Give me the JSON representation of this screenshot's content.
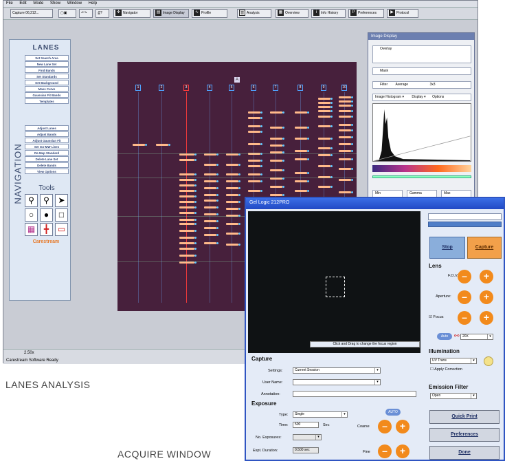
{
  "main": {
    "menu": [
      "File",
      "Edit",
      "Mode",
      "Show",
      "Window",
      "Help"
    ],
    "toolbar": {
      "capture_label": "Capture 06,212...",
      "buttons": [
        "Navigator",
        "Image Display",
        "Profile",
        "Analysis",
        "Overview",
        "Info History",
        "Preferences",
        "Protocol"
      ]
    },
    "nav": {
      "vertical_label": "NAVIGATION",
      "title": "LANES",
      "items": [
        "Set Search Area",
        "New Lane Set",
        "Find Bands",
        "Set Standards",
        "Set Background",
        "Mass Curve",
        "Gaussian Fit Bands",
        "Templates",
        "Adjust Lanes",
        "Adjust Bands",
        "Adjust Gaussian Fit",
        "Set Iso-MW Lines",
        "Re-Map Standard",
        "Delete Lane Set",
        "Delete Bands",
        "View Options"
      ],
      "tools_title": "Tools",
      "brand": "Carestream"
    },
    "gel": {
      "marker": "A",
      "lanes": [
        "1",
        "2",
        "3",
        "4",
        "5",
        "6",
        "7",
        "8",
        "9",
        "10"
      ]
    },
    "image_display": {
      "title": "Image Display",
      "rows": [
        "Overlay",
        "Mask",
        "Filter"
      ],
      "filter_value": "Average",
      "filter_size": "3x3",
      "histogram_label": "Image Histogram",
      "display_label": "Display",
      "options_label": "Options",
      "bottom_selects": [
        "Min",
        "Gamma",
        "Max"
      ]
    },
    "status": {
      "zoom": "2.50x",
      "message": "Carestream Software Ready"
    }
  },
  "acquire": {
    "title": "Gel Logic 212PRO",
    "preview_hint": "Click and Drag to change the focus region",
    "stop_label": "Stop",
    "capture_button_label": "Capture",
    "capture_section": {
      "title": "Capture",
      "settings_label": "Settings:",
      "settings_value": "Current Session",
      "user_label": "User Name:",
      "user_value": "",
      "annotation_label": "Annotation:",
      "annotation_value": ""
    },
    "exposure": {
      "title": "Exposure",
      "type_label": "Type:",
      "type_value": "Single",
      "time_label": "Time:",
      "time_value": "500",
      "time_unit": "Sec",
      "num_label": "No. Exposures:",
      "num_value": "",
      "expt_label": "Expt. Duration:",
      "expt_value": "0.500 sec",
      "auto_label": "AUTO",
      "coarse_label": "Coarse",
      "fine_label": "Fine"
    },
    "lens": {
      "title": "Lens",
      "fov_label": "F.O.V.",
      "aperture_label": "Aperture:",
      "focus_label": "Focus",
      "auto_label": "Auto",
      "zoom_value": "20X"
    },
    "illumination": {
      "title": "Illumination",
      "value": "UV Trans",
      "apply_label": "Apply Correction"
    },
    "emission": {
      "title": "Emission Filter",
      "value": "Open"
    },
    "buttons": [
      "Quick Print",
      "Preferences",
      "Done"
    ]
  },
  "captions": {
    "lanes": "LANES ANALYSIS",
    "acquire": "ACQUIRE WINDOW"
  },
  "colors": {
    "accent_orange": "#f28a1c",
    "titlebar_blue": "#2149c4",
    "gel_bg": "#47203c"
  }
}
